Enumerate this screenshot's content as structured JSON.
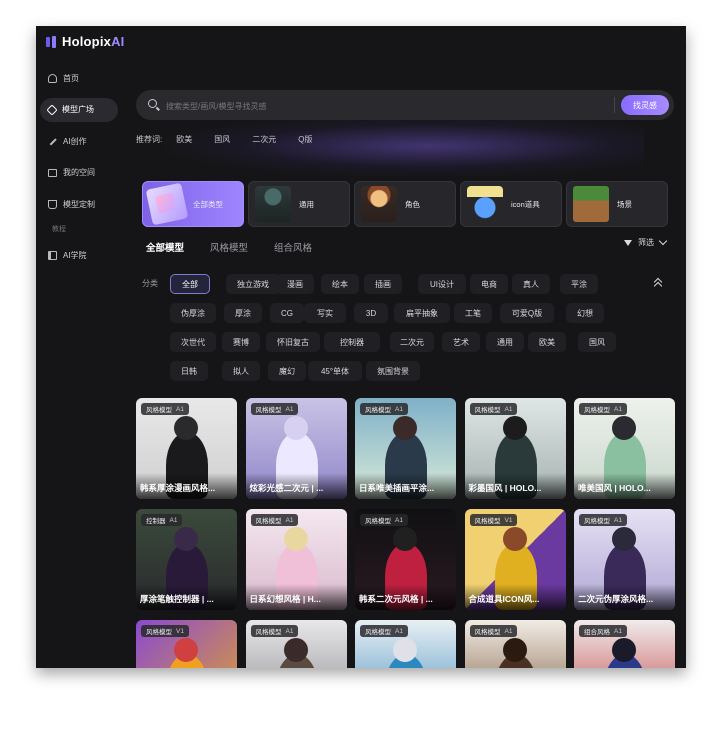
{
  "app": {
    "brand_main": "Holopix",
    "brand_accent": "AI",
    "accent_color": "#8b6cff"
  },
  "sidebar": {
    "items": [
      {
        "label": "首页",
        "icon": "home-icon"
      },
      {
        "label": "模型广场",
        "icon": "cube-icon",
        "active": true
      },
      {
        "label": "AI创作",
        "icon": "magic-wand-icon"
      },
      {
        "label": "我的空间",
        "icon": "folder-icon"
      },
      {
        "label": "模型定制",
        "icon": "flask-icon"
      }
    ],
    "section_label": "教程",
    "bottom_items": [
      {
        "label": "AI学院",
        "icon": "book-icon"
      }
    ]
  },
  "search": {
    "placeholder": "搜索类型/画风/模型寻找灵感",
    "button_label": "找灵感"
  },
  "recommend": {
    "label": "推荐词:",
    "tags": [
      "欧美",
      "国风",
      "二次元",
      "Q版"
    ]
  },
  "categories": [
    {
      "label": "全部类型",
      "active": true
    },
    {
      "label": "通用"
    },
    {
      "label": "角色"
    },
    {
      "label": "icon道具"
    },
    {
      "label": "场景"
    }
  ],
  "tabs": [
    {
      "label": "全部模型",
      "active": true
    },
    {
      "label": "风格模型"
    },
    {
      "label": "组合风格"
    }
  ],
  "filter": {
    "label": "筛选"
  },
  "classify": {
    "label": "分类",
    "rows": [
      [
        "全部",
        "独立游戏",
        "漫画",
        "绘本",
        "插画",
        "UI设计",
        "电商",
        "真人",
        "平涂"
      ],
      [
        "伪厚涂",
        "厚涂",
        "CG",
        "写实",
        "3D",
        "扁平抽象",
        "工笔",
        "可爱Q版",
        "幻想"
      ],
      [
        "次世代",
        "赛博",
        "怀旧复古",
        "控制器",
        "二次元",
        "艺术",
        "通用",
        "欧美",
        "国风"
      ],
      [
        "日韩",
        "拟人",
        "魔幻",
        "45°单体",
        "氛围背景"
      ]
    ]
  },
  "cards": [
    {
      "badge": "风格模型",
      "version": "A1",
      "title": "韩系厚涂漫画风格..."
    },
    {
      "badge": "风格模型",
      "version": "A1",
      "title": "炫彩光感二次元 | ..."
    },
    {
      "badge": "风格模型",
      "version": "A1",
      "title": "日系唯美插画平涂..."
    },
    {
      "badge": "风格模型",
      "version": "A1",
      "title": "彩墨国风 | HOLO..."
    },
    {
      "badge": "风格模型",
      "version": "A1",
      "title": "唯美国风 | HOLO..."
    },
    {
      "badge": "控制器",
      "version": "A1",
      "title": "厚涂笔触控制器 | ..."
    },
    {
      "badge": "风格模型",
      "version": "A1",
      "title": "日系幻想风格 | H..."
    },
    {
      "badge": "风格模型",
      "version": "A1",
      "title": "韩系二次元风格 | ..."
    },
    {
      "badge": "风格模型",
      "version": "V1",
      "title": "合成道具ICON风..."
    },
    {
      "badge": "风格模型",
      "version": "A1",
      "title": "二次元伪厚涂风格..."
    },
    {
      "badge": "风格模型",
      "version": "V1",
      "title": ""
    },
    {
      "badge": "风格模型",
      "version": "A1",
      "title": ""
    },
    {
      "badge": "风格模型",
      "version": "A1",
      "title": ""
    },
    {
      "badge": "风格模型",
      "version": "A1",
      "title": ""
    },
    {
      "badge": "组合风格",
      "version": "A1",
      "title": ""
    }
  ]
}
